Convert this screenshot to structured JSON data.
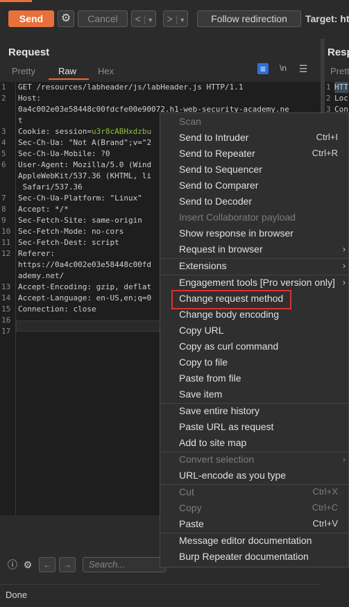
{
  "toolbar": {
    "send": "Send",
    "cancel": "Cancel",
    "back": "<",
    "back_menu": "▾",
    "forward": ">",
    "forward_menu": "▾",
    "follow": "Follow redirection",
    "target": "Target: htt"
  },
  "request_panel": {
    "title": "Request",
    "tabs": [
      "Pretty",
      "Raw",
      "Hex"
    ],
    "active_tab": "Raw",
    "newline_toggle": "\\n"
  },
  "response_panel": {
    "title": "Resp",
    "tab": "Prett",
    "lines": [
      "HTT",
      "Loc",
      "Con"
    ]
  },
  "editor_lines": [
    {
      "n": "1",
      "text": "GET /resources/labheader/js/labHeader.js HTTP/1.1"
    },
    {
      "n": "2",
      "text": "Host:"
    },
    {
      "n": "",
      "text": "0a4c002e03e58448c00fdcfe00e90072.h1-web-security-academy.ne"
    },
    {
      "n": "",
      "text": "t"
    },
    {
      "n": "3",
      "key": "Cookie:",
      "val": " session=",
      "extra": "u3r8cABHxdzbu"
    },
    {
      "n": "4",
      "key": "Sec-Ch-Ua:",
      "val": " \"Not A(Brand\";v=\"2"
    },
    {
      "n": "5",
      "key": "Sec-Ch-Ua-Mobile:",
      "val": " ?0"
    },
    {
      "n": "6",
      "key": "User-Agent:",
      "val": " Mozilla/5.0 (Wind"
    },
    {
      "n": "",
      "text": "AppleWebKit/537.36 (KHTML, li"
    },
    {
      "n": "",
      "text": " Safari/537.36"
    },
    {
      "n": "7",
      "key": "Sec-Ch-Ua-Platform:",
      "val": " \"Linux\""
    },
    {
      "n": "8",
      "key": "Accept:",
      "val": " */*"
    },
    {
      "n": "9",
      "key": "Sec-Fetch-Site:",
      "val": " same-origin"
    },
    {
      "n": "10",
      "key": "Sec-Fetch-Mode:",
      "val": " no-cors"
    },
    {
      "n": "11",
      "key": "Sec-Fetch-Dest:",
      "val": " script"
    },
    {
      "n": "12",
      "key": "Referer:",
      "val": ""
    },
    {
      "n": "",
      "text": "https://0a4c002e03e58448c00fd"
    },
    {
      "n": "",
      "text": "ademy.net/"
    },
    {
      "n": "13",
      "key": "Accept-Encoding:",
      "val": " gzip, deflat"
    },
    {
      "n": "14",
      "key": "Accept-Language:",
      "val": " en-US,en;q=0"
    },
    {
      "n": "15",
      "key": "Connection:",
      "val": " close"
    },
    {
      "n": "16",
      "text": ""
    },
    {
      "n": "17",
      "text": ""
    }
  ],
  "search": {
    "placeholder": "Search..."
  },
  "status": "Done",
  "context_menu": [
    {
      "label": "Scan",
      "disabled": true
    },
    {
      "label": "Send to Intruder",
      "shortcut": "Ctrl+I"
    },
    {
      "label": "Send to Repeater",
      "shortcut": "Ctrl+R"
    },
    {
      "label": "Send to Sequencer"
    },
    {
      "label": "Send to Comparer"
    },
    {
      "label": "Send to Decoder"
    },
    {
      "label": "Insert Collaborator payload",
      "disabled": true
    },
    {
      "label": "Show response in browser"
    },
    {
      "label": "Request in browser",
      "submenu": true
    },
    {
      "sep": true
    },
    {
      "label": "Extensions",
      "submenu": true
    },
    {
      "sep": true
    },
    {
      "label": "Engagement tools [Pro version only]",
      "submenu": true
    },
    {
      "label": "Change request method",
      "highlighted": true
    },
    {
      "label": "Change body encoding"
    },
    {
      "label": "Copy URL"
    },
    {
      "label": "Copy as curl command"
    },
    {
      "label": "Copy to file"
    },
    {
      "label": "Paste from file"
    },
    {
      "label": "Save item"
    },
    {
      "sep": true
    },
    {
      "label": "Save entire history"
    },
    {
      "label": "Paste URL as request"
    },
    {
      "label": "Add to site map"
    },
    {
      "sep": true
    },
    {
      "label": "Convert selection",
      "disabled": true,
      "submenu": true
    },
    {
      "label": "URL-encode as you type"
    },
    {
      "sep": true
    },
    {
      "label": "Cut",
      "shortcut": "Ctrl+X",
      "disabled": true
    },
    {
      "label": "Copy",
      "shortcut": "Ctrl+C",
      "disabled": true
    },
    {
      "label": "Paste",
      "shortcut": "Ctrl+V"
    },
    {
      "sep": true
    },
    {
      "label": "Message editor documentation"
    },
    {
      "label": "Burp Repeater documentation"
    }
  ],
  "colors": {
    "accent": "#e8703a",
    "highlight_box": "#e03030",
    "cookie_value": "#8fbf3a"
  }
}
